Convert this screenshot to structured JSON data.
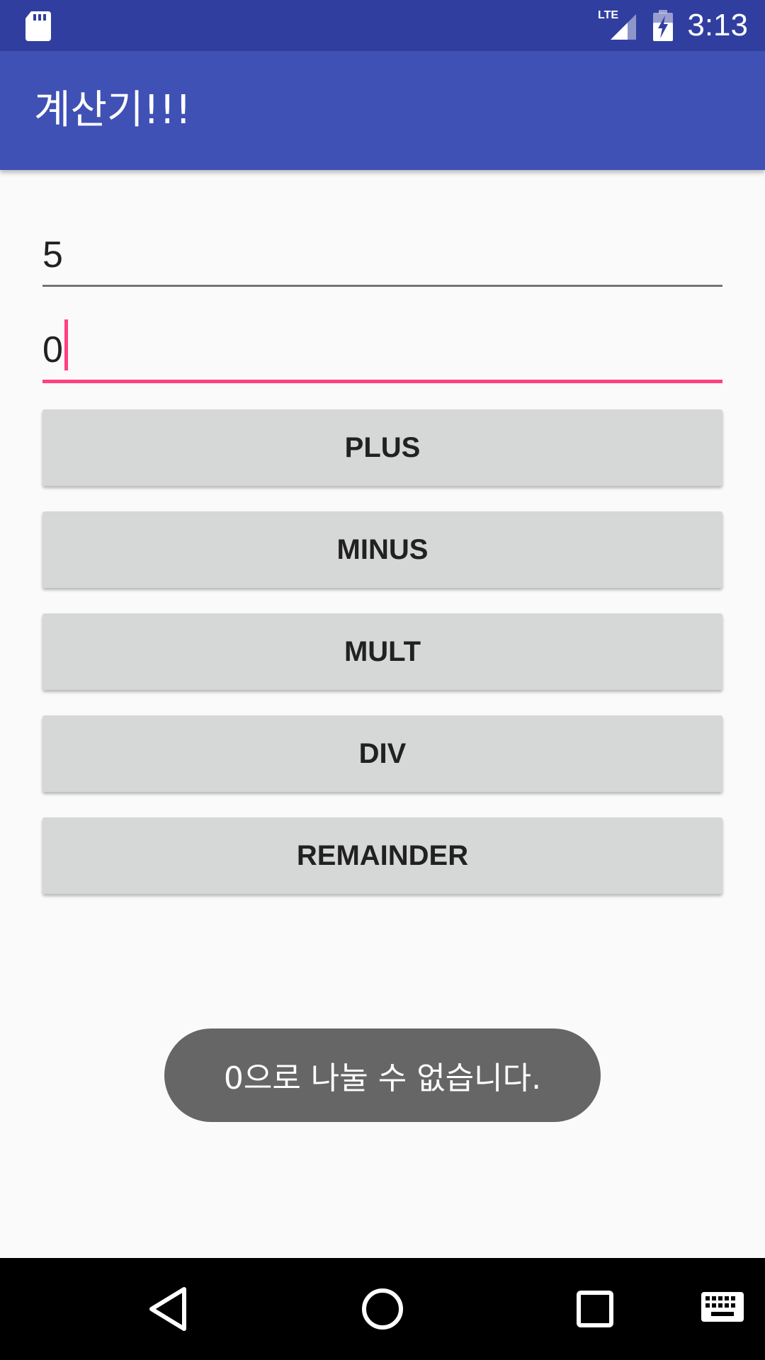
{
  "status_bar": {
    "time": "3:13",
    "network_label": "LTE",
    "icons": [
      "sd-card-icon",
      "lte-signal-icon",
      "battery-charging-icon"
    ]
  },
  "app_bar": {
    "title": "계산기!!!"
  },
  "inputs": {
    "first_value": "5",
    "second_value": "0"
  },
  "buttons": {
    "plus": "PLUS",
    "minus": "MINUS",
    "mult": "MULT",
    "div": "DIV",
    "remainder": "REMAINDER"
  },
  "toast": {
    "message": "0으로 나눌 수 없습니다."
  },
  "nav_bar": {
    "icons": [
      "back-icon",
      "home-icon",
      "recents-icon",
      "keyboard-icon"
    ]
  },
  "colors": {
    "status_bar": "#303f9f",
    "app_bar": "#3f51b5",
    "accent": "#ff4081",
    "button": "#d6d7d7",
    "toast": "#666666"
  }
}
